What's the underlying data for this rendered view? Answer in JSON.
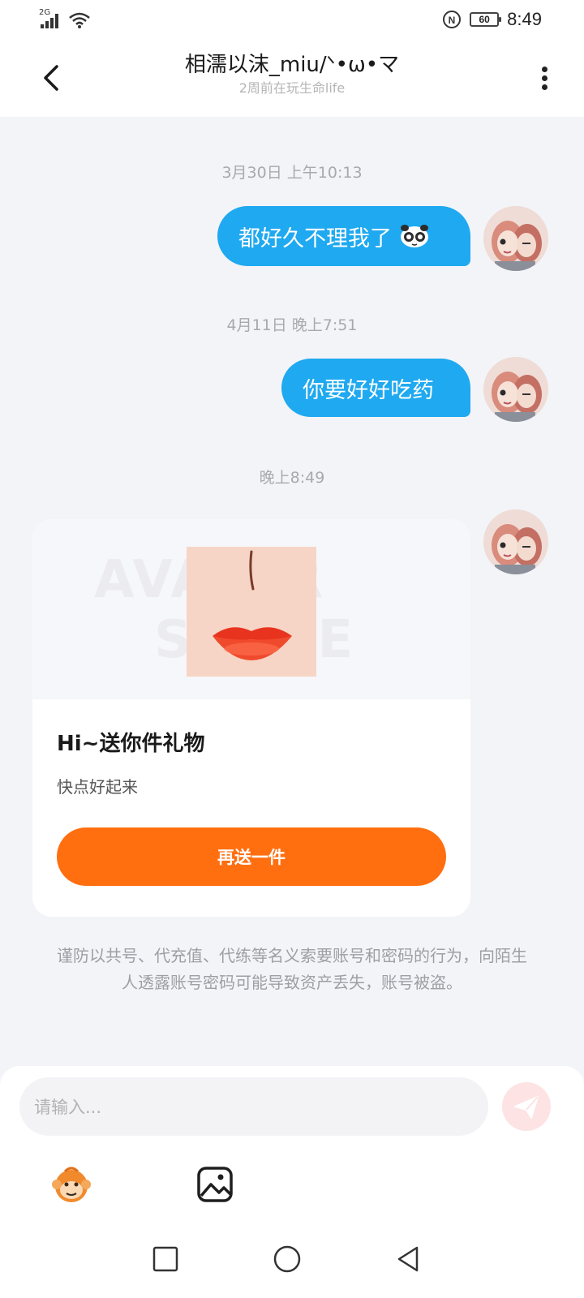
{
  "status_bar": {
    "network": "2G",
    "battery": "60",
    "time": "8:49"
  },
  "header": {
    "title": "相濡以沫_miu/ᐠ•ω•マ",
    "subtitle": "2周前在玩生命life"
  },
  "messages": [
    {
      "timestamp": "3月30日 上午10:13",
      "text": "都好久不理我了"
    },
    {
      "timestamp": "4月11日 晚上7:51",
      "text": "你要好好吃药"
    }
  ],
  "gift": {
    "timestamp": "晚上8:49",
    "watermark_line1": "AVATAR",
    "watermark_line2": "STORE",
    "title": "Hi~送你件礼物",
    "subtitle": "快点好起来",
    "button_label": "再送一件"
  },
  "notice": "谨防以共号、代充值、代练等名义索要账号和密码的行为，向陌生人透露账号密码可能导致资产丢失，账号被盗。",
  "input": {
    "placeholder": "请输入..."
  },
  "colors": {
    "bubble": "#1fa9f0",
    "gift_button": "#ff6f10",
    "send_button": "#fde3e3",
    "background": "#f3f4f8"
  }
}
